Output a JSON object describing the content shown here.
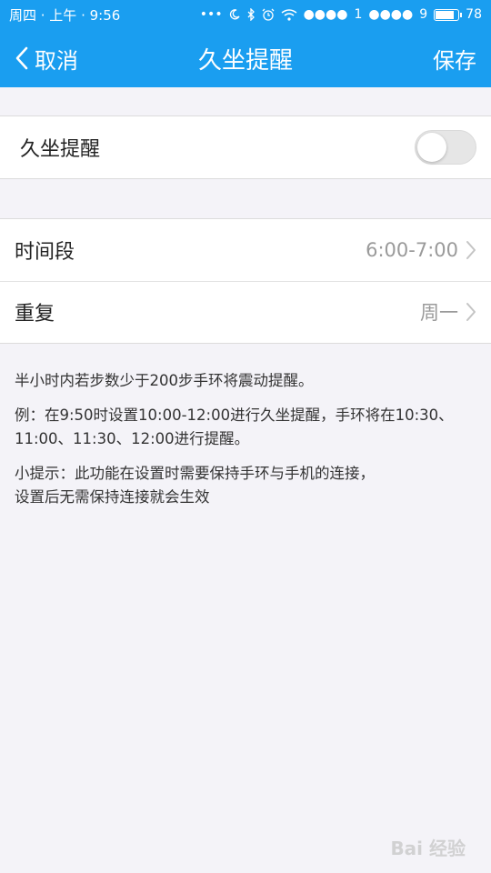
{
  "status_bar": {
    "left_text": "周四 · 上午 · 9:56",
    "signal1_label": "1",
    "signal2_label": "9",
    "battery_level": "78"
  },
  "nav": {
    "back_label": "取消",
    "title": "久坐提醒",
    "save_label": "保存"
  },
  "reminder": {
    "label": "久坐提醒",
    "enabled": false
  },
  "settings": {
    "time_period_label": "时间段",
    "time_period_value": "6:00-7:00",
    "repeat_label": "重复",
    "repeat_value": "周一"
  },
  "notes": {
    "line1": "半小时内若步数少于200步手环将震动提醒。",
    "line2": "例：在9:50时设置10:00-12:00进行久坐提醒，手环将在10:30、11:00、11:30、12:00进行提醒。",
    "line3a": "小提示：此功能在设置时需要保持手环与手机的连接，",
    "line3b": "设置后无需保持连接就会生效"
  },
  "watermark": "Bai 经验",
  "colors": {
    "primary": "#1a9ef0",
    "background": "#f4f3f8"
  }
}
